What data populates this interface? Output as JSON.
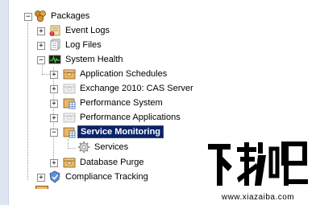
{
  "tree": {
    "root": {
      "label": "Packages",
      "expander": "−",
      "icon": "packages-icon"
    },
    "nodes": [
      {
        "label": "Event Logs",
        "expander": "+",
        "icon": "event-logs-icon"
      },
      {
        "label": "Log Files",
        "expander": "+",
        "icon": "log-files-icon"
      },
      {
        "label": "System Health",
        "expander": "−",
        "icon": "system-health-icon"
      },
      {
        "label": "Application Schedules",
        "expander": "+",
        "icon": "package-folder-icon"
      },
      {
        "label": "Exchange 2010: CAS Server",
        "expander": "+",
        "icon": "disabled-package-icon"
      },
      {
        "label": "Performance System",
        "expander": "+",
        "icon": "package-grid-icon"
      },
      {
        "label": "Performance Applications",
        "expander": "+",
        "icon": "disabled-package-icon"
      },
      {
        "label": "Service Monitoring",
        "expander": "−",
        "icon": "package-grid-icon",
        "selected": true
      },
      {
        "label": "Services",
        "icon": "gear-icon"
      },
      {
        "label": "Database Purge",
        "expander": "+",
        "icon": "package-folder-icon"
      },
      {
        "label": "Compliance Tracking",
        "expander": "+",
        "icon": "compliance-icon"
      }
    ]
  },
  "watermark": {
    "text": "www.xiazaiba.com",
    "logo": "xiazaiba-logo"
  }
}
